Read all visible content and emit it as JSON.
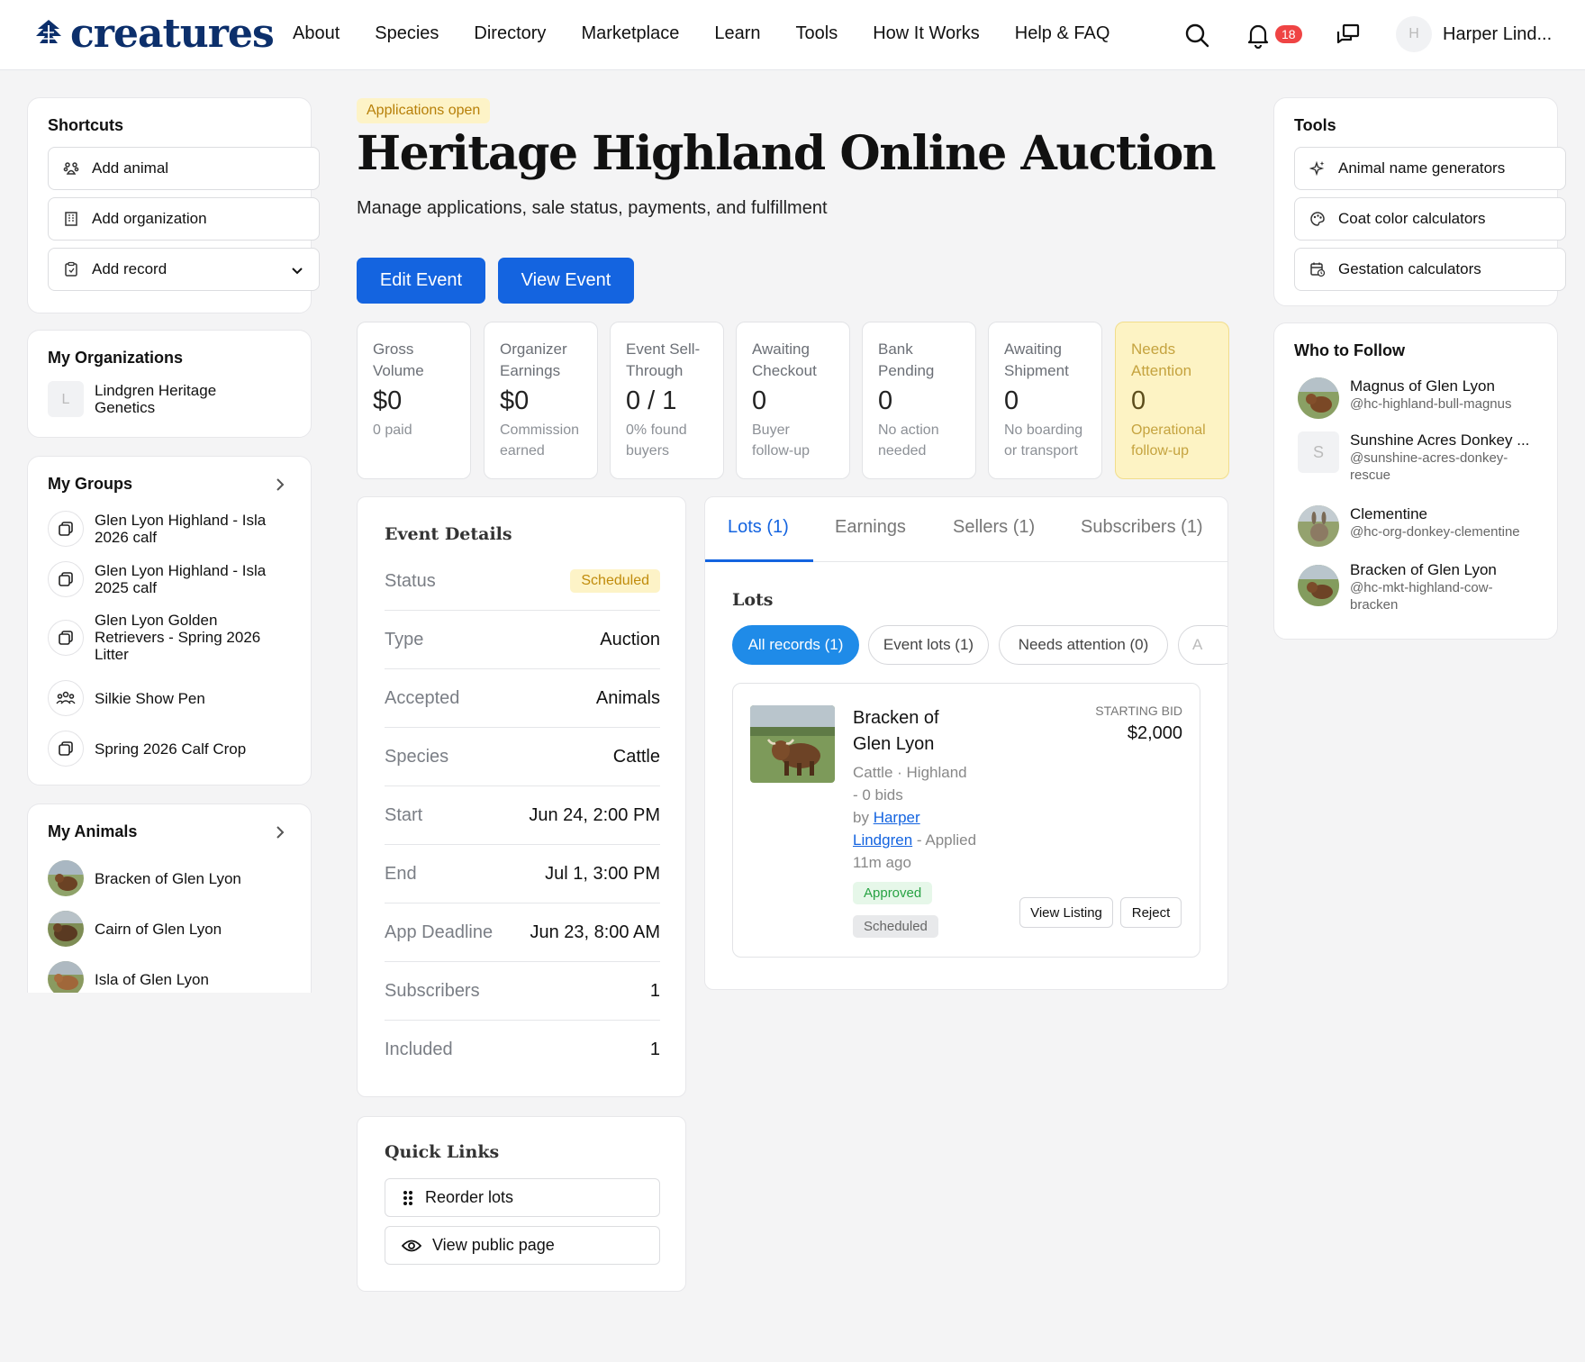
{
  "brand": {
    "name": "creatures",
    "color": "#0c2f6b"
  },
  "nav": [
    "About",
    "Species",
    "Directory",
    "Marketplace",
    "Learn",
    "Tools",
    "How It Works",
    "Help & FAQ"
  ],
  "header": {
    "notification_count": "18",
    "user_initial": "H",
    "user_name": "Harper Lind..."
  },
  "shortcuts": {
    "title": "Shortcuts",
    "items": [
      {
        "label": "Add animal",
        "icon": "paw-icon"
      },
      {
        "label": "Add organization",
        "icon": "building-icon"
      },
      {
        "label": "Add record",
        "icon": "clipboard-icon"
      }
    ]
  },
  "my_organizations": {
    "title": "My Organizations",
    "items": [
      {
        "initial": "L",
        "name": "Lindgren Heritage Genetics"
      }
    ]
  },
  "my_groups": {
    "title": "My Groups",
    "items": [
      {
        "name": "Glen Lyon Highland - Isla 2026 calf"
      },
      {
        "name": "Glen Lyon Highland - Isla 2025 calf"
      },
      {
        "name": "Glen Lyon Golden Retrievers - Spring 2026 Litter"
      },
      {
        "name": "Silkie Show Pen"
      },
      {
        "name": "Spring 2026 Calf Crop"
      }
    ]
  },
  "my_animals": {
    "title": "My Animals",
    "items": [
      {
        "name": "Bracken of Glen Lyon"
      },
      {
        "name": "Cairn of Glen Lyon"
      },
      {
        "name": "Isla of Glen Lyon"
      }
    ]
  },
  "event": {
    "status_badge": "Applications open",
    "title": "Heritage Highland Online Auction",
    "subtitle": "Manage applications, sale status, payments, and fulfillment",
    "edit_label": "Edit Event",
    "view_label": "View Event"
  },
  "stats": [
    {
      "label": "Gross Volume",
      "value": "$0",
      "sub": "0 paid"
    },
    {
      "label": "Organizer Earnings",
      "value": "$0",
      "sub": "Commission earned"
    },
    {
      "label": "Event Sell-Through",
      "value": "0 / 1",
      "sub": "0% found buyers"
    },
    {
      "label": "Awaiting Checkout",
      "value": "0",
      "sub": "Buyer follow-up"
    },
    {
      "label": "Bank Pending",
      "value": "0",
      "sub": "No action needed"
    },
    {
      "label": "Awaiting Shipment",
      "value": "0",
      "sub": "No boarding or transport"
    },
    {
      "label": "Needs Attention",
      "value": "0",
      "sub": "Operational follow-up"
    }
  ],
  "event_details": {
    "title": "Event Details",
    "rows": [
      {
        "key": "Status",
        "value": "Scheduled"
      },
      {
        "key": "Type",
        "value": "Auction"
      },
      {
        "key": "Accepted",
        "value": "Animals"
      },
      {
        "key": "Species",
        "value": "Cattle"
      },
      {
        "key": "Start",
        "value": "Jun 24, 2:00 PM"
      },
      {
        "key": "End",
        "value": "Jul 1, 3:00 PM"
      },
      {
        "key": "App Deadline",
        "value": "Jun 23, 8:00 AM"
      },
      {
        "key": "Subscribers",
        "value": "1"
      },
      {
        "key": "Included",
        "value": "1"
      }
    ]
  },
  "quick_links": {
    "title": "Quick Links",
    "items": [
      {
        "label": "Reorder lots"
      },
      {
        "label": "View public page"
      }
    ]
  },
  "tabs": [
    "Lots (1)",
    "Earnings",
    "Sellers (1)",
    "Subscribers (1)"
  ],
  "lots": {
    "title": "Lots",
    "filters": [
      "All records (1)",
      "Event lots (1)",
      "Needs attention (0)",
      "A"
    ],
    "card": {
      "name": "Bracken of Glen Lyon",
      "species": "Cattle · Highland",
      "bids": "- 0 bids",
      "by": "by",
      "seller": "Harper Lindgren",
      "applied": "- Applied 11m ago",
      "bid_label": "STARTING BID",
      "bid_value": "$2,000",
      "approved": "Approved",
      "scheduled": "Scheduled",
      "view_listing": "View Listing",
      "reject": "Reject"
    }
  },
  "tools": {
    "title": "Tools",
    "items": [
      {
        "label": "Animal name generators"
      },
      {
        "label": "Coat color calculators"
      },
      {
        "label": "Gestation calculators"
      }
    ]
  },
  "who_to_follow": {
    "title": "Who to Follow",
    "items": [
      {
        "name": "Magnus of Glen Lyon",
        "handle": "@hc-highland-bull-magnus"
      },
      {
        "name": "Sunshine Acres Donkey ...",
        "handle": "@sunshine-acres-donkey-rescue",
        "initial": "S"
      },
      {
        "name": "Clementine",
        "handle": "@hc-org-donkey-clementine"
      },
      {
        "name": "Bracken of Glen Lyon",
        "handle": "@hc-mkt-highland-cow-bracken"
      }
    ]
  }
}
